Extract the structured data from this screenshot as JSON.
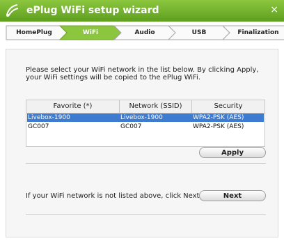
{
  "window": {
    "title": "ePlug WiFi setup wizard",
    "close_symbol": "×",
    "logo_icon": "eplug-logo-icon",
    "colors": {
      "titlebar": "#6eb12a",
      "active_step": "#8cc63f",
      "selection": "#3d7cd1"
    }
  },
  "steps": [
    {
      "label": "HomePlug",
      "active": false
    },
    {
      "label": "WiFi",
      "active": true
    },
    {
      "label": "Audio",
      "active": false
    },
    {
      "label": "USB",
      "active": false
    },
    {
      "label": "Finalization",
      "active": false
    }
  ],
  "intro_text": "Please select your WiFi network in the list below. By clicking Apply, your WiFi settings will be copied to the ePlug WiFi.",
  "table": {
    "columns": [
      "Favorite (*)",
      "Network (SSID)",
      "Security"
    ],
    "rows": [
      {
        "favorite": "Livebox-1900",
        "ssid": "Livebox-1900",
        "security": "WPA2-PSK (AES)",
        "selected": true
      },
      {
        "favorite": "GC007",
        "ssid": "GC007",
        "security": "WPA2-PSK (AES)",
        "selected": false
      }
    ]
  },
  "buttons": {
    "apply": "Apply",
    "next": "Next"
  },
  "next_note": "If your WiFi network is not listed above, click Next."
}
